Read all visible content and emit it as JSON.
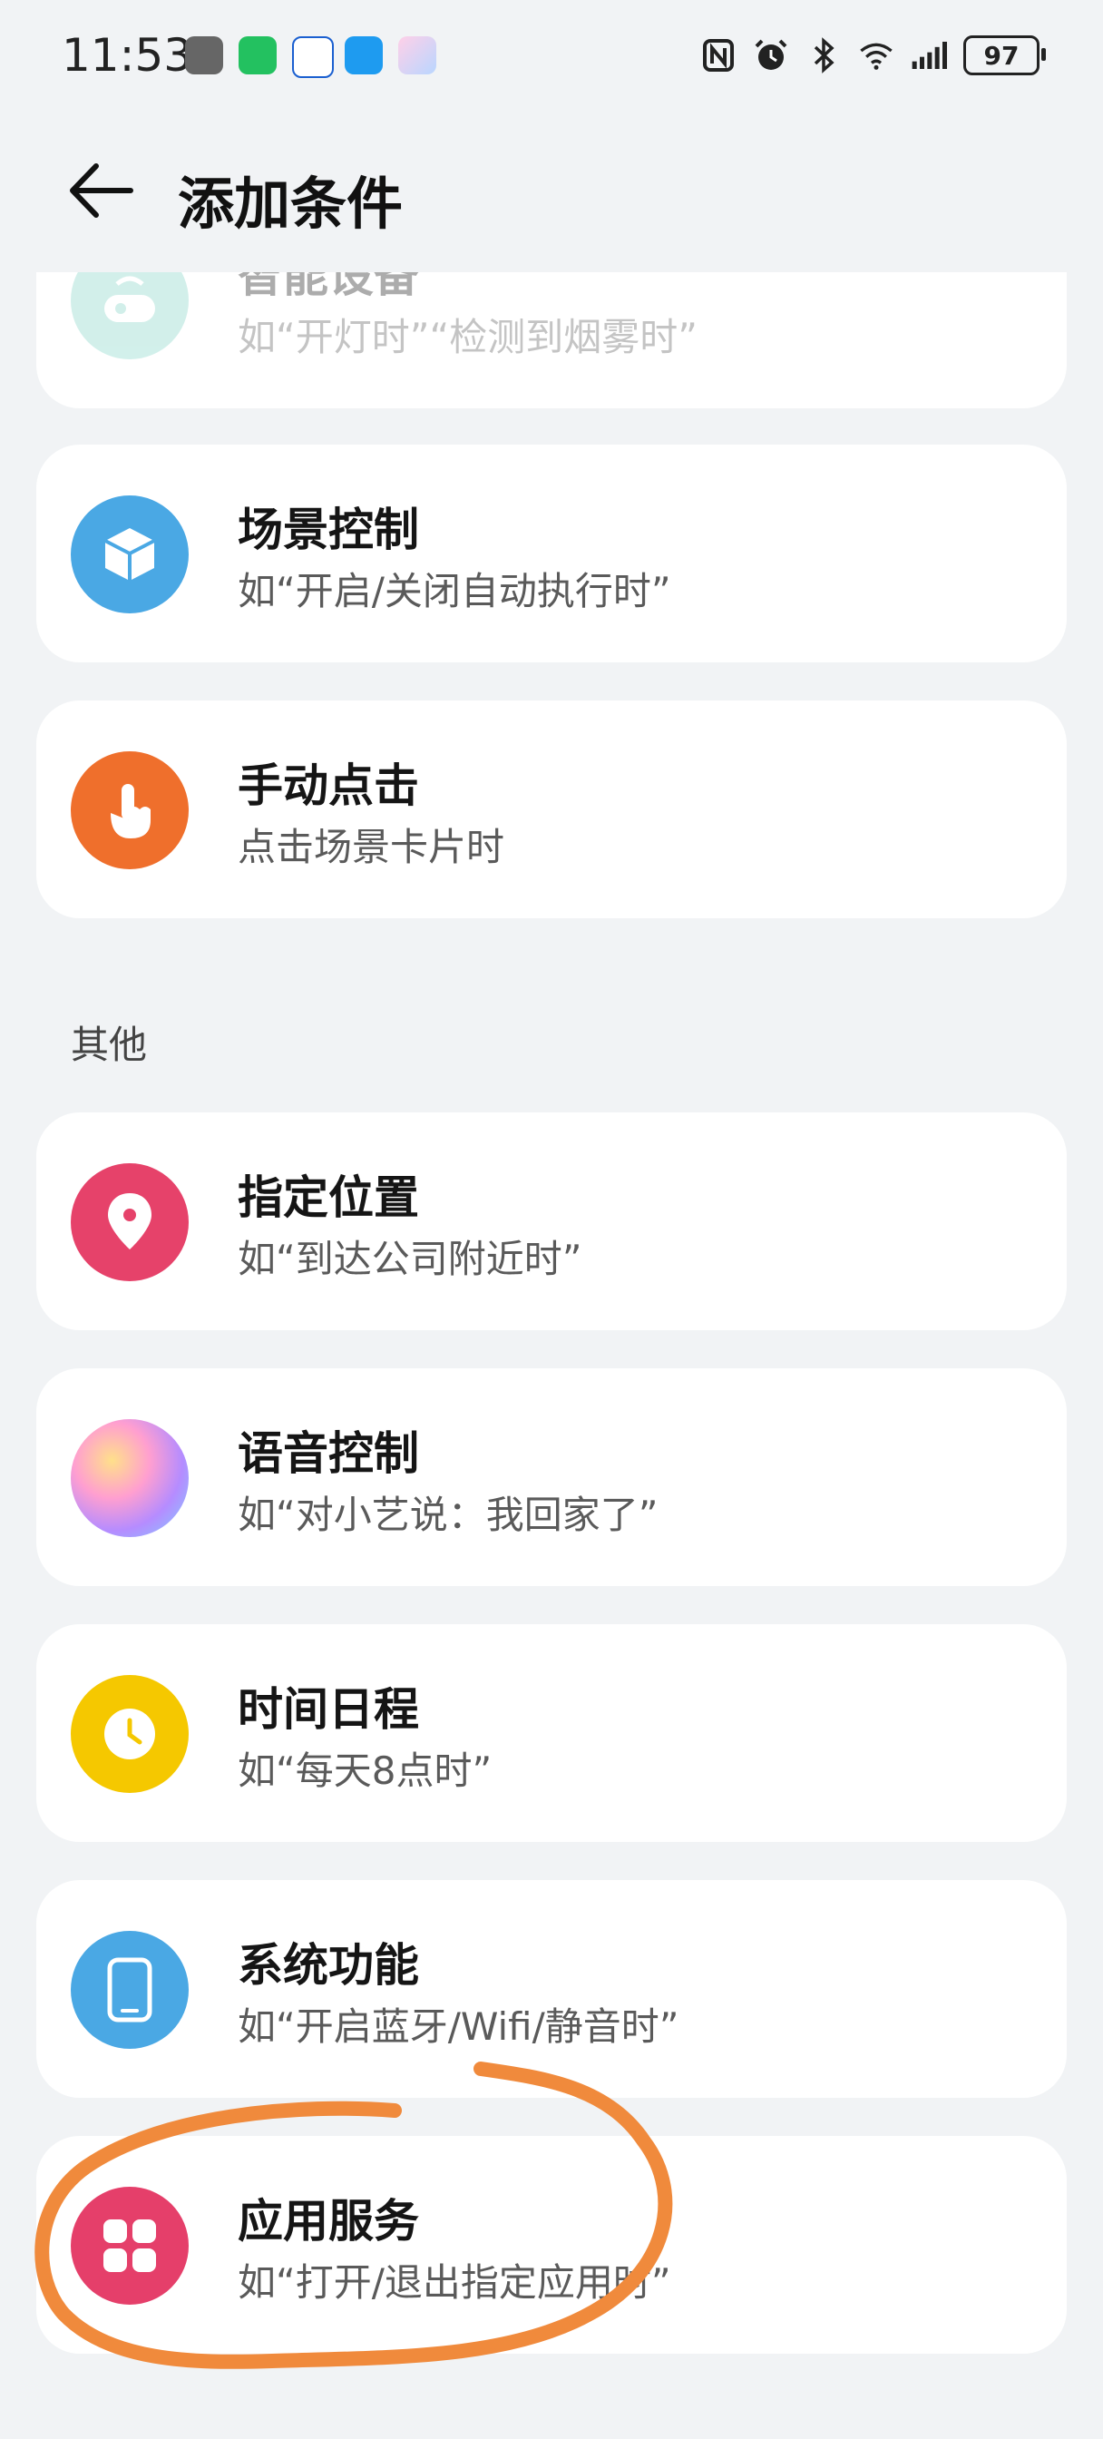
{
  "status_bar": {
    "time": "11:53",
    "battery": "97",
    "notification_icons": [
      "reader-app-icon",
      "wechat-icon",
      "bank-app-icon",
      "search-app-icon",
      "celia-icon"
    ],
    "system_icons": [
      "nfc-icon",
      "alarm-icon",
      "bluetooth-icon",
      "wifi-icon",
      "signal-icon"
    ]
  },
  "header": {
    "title": "添加条件",
    "back_icon": "back-arrow-icon"
  },
  "sections": {
    "other_label": "其他"
  },
  "items": [
    {
      "key": "smart-device",
      "title": "智能设备",
      "subtitle": "如“开灯时”“检测到烟雾时”",
      "icon": "smart-device-icon",
      "color": "#7fd3c6"
    },
    {
      "key": "scene-control",
      "title": "场景控制",
      "subtitle": "如“开启/关闭自动执行时”",
      "icon": "cube-icon",
      "color": "#4aa8e4"
    },
    {
      "key": "manual-click",
      "title": "手动点击",
      "subtitle": "点击场景卡片时",
      "icon": "tap-hand-icon",
      "color": "#ef6f2c"
    },
    {
      "key": "location",
      "title": "指定位置",
      "subtitle": "如“到达公司附近时”",
      "icon": "location-pin-icon",
      "color": "#e6426a"
    },
    {
      "key": "voice-control",
      "title": "语音控制",
      "subtitle": "如“对小艺说：我回家了”",
      "icon": "celia-orb-icon",
      "color": "#c98be8"
    },
    {
      "key": "time-schedule",
      "title": "时间日程",
      "subtitle": "如“每天8点时”",
      "icon": "clock-icon",
      "color": "#f5c800"
    },
    {
      "key": "system-function",
      "title": "系统功能",
      "subtitle": "如“开启蓝牙/Wifi/静音时”",
      "icon": "phone-icon",
      "color": "#4aa8e4"
    },
    {
      "key": "app-service",
      "title": "应用服务",
      "subtitle": "如“打开/退出指定应用时”",
      "icon": "apps-grid-icon",
      "color": "#e53f6a"
    }
  ],
  "annotation": {
    "type": "hand-drawn-circle",
    "color": "#f08a3c",
    "target": "app-service"
  }
}
